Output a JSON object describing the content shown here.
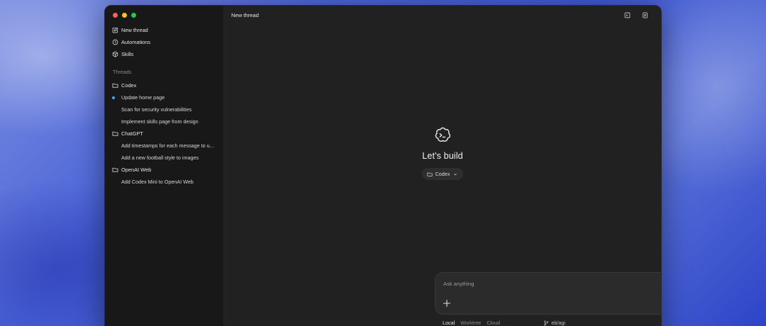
{
  "window": {
    "title": "New thread"
  },
  "sidebar": {
    "nav": [
      {
        "label": "New thread",
        "icon": "edit-icon"
      },
      {
        "label": "Automations",
        "icon": "clock-icon"
      },
      {
        "label": "Skills",
        "icon": "cube-icon"
      }
    ],
    "threads_label": "Threads",
    "groups": [
      {
        "name": "Codex",
        "threads": [
          {
            "title": "Update home page",
            "active": true
          },
          {
            "title": "Scan for security vulnerabilities",
            "active": false
          },
          {
            "title": "Implement skills page from design",
            "active": false
          }
        ]
      },
      {
        "name": "ChatGPT",
        "threads": [
          {
            "title": "Add timestamps for each message to u...",
            "active": false
          },
          {
            "title": "Add a new football style to images",
            "active": false
          }
        ]
      },
      {
        "name": "OpenAI Web",
        "threads": [
          {
            "title": "Add Codex Mini to OpenAI Web",
            "active": false
          }
        ]
      }
    ]
  },
  "hero": {
    "title": "Let's build",
    "project": "Codex"
  },
  "composer": {
    "placeholder": "Ask anything",
    "value": ""
  },
  "modes": {
    "local": "Local",
    "worktree": "Worktree",
    "cloud": "Cloud",
    "selected": "Local"
  },
  "branch": "eb/agi",
  "colors": {
    "accent_dot": "#4aa3ff",
    "window_bg": "#212121",
    "sidebar_bg": "#181818"
  }
}
